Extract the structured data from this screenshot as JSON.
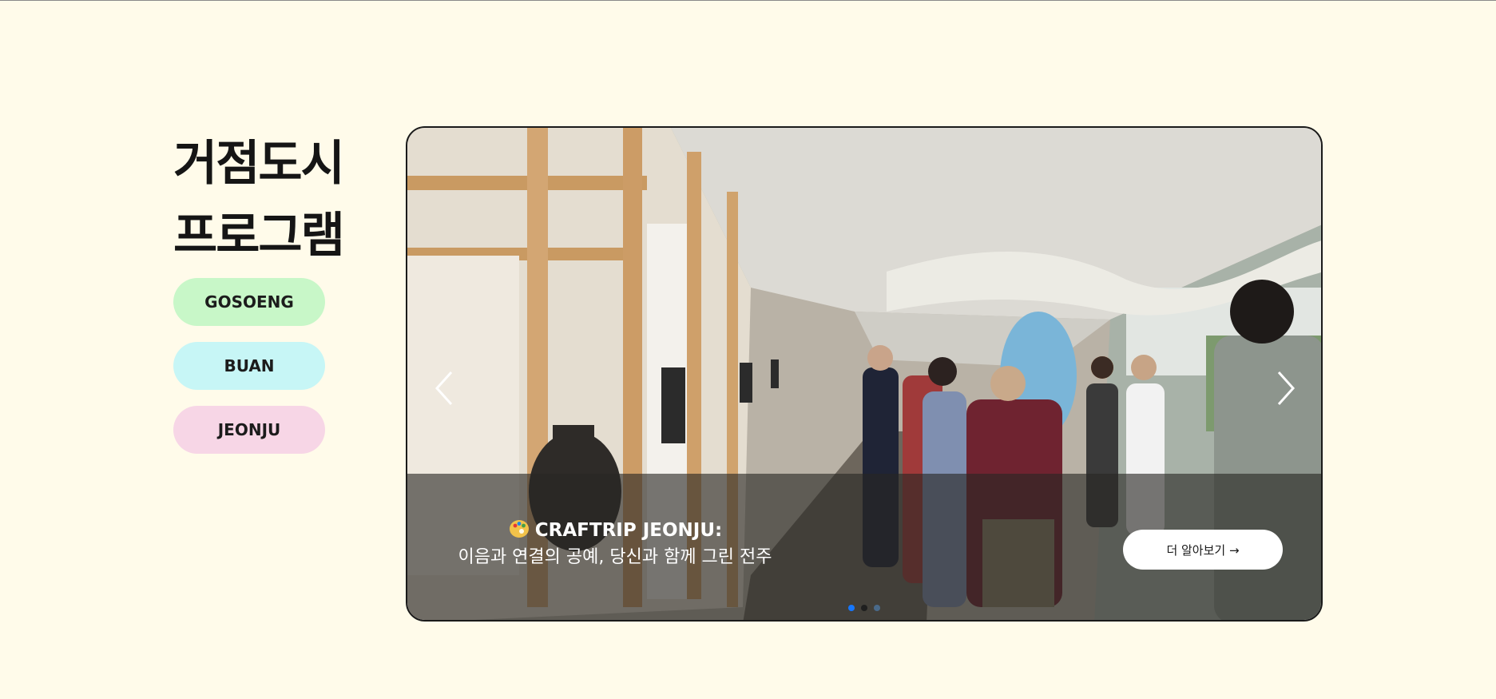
{
  "page": {
    "background": "#fffbea"
  },
  "sidebar": {
    "title_line1": "거점도시",
    "title_line2": "프로그램",
    "buttons": [
      {
        "label": "GOSOENG",
        "color": "#c8f7c8"
      },
      {
        "label": "BUAN",
        "color": "#c7f6f6"
      },
      {
        "label": "JEONJU",
        "color": "#f7d6e6"
      }
    ]
  },
  "slider": {
    "slide": {
      "emoji": "palette-icon",
      "title": "CRAFTRIP JEONJU:",
      "subtitle": "이음과 연결의 공예, 당신과 함께 그린 전주",
      "button_label": "더 알아보기 →",
      "image": "gallery-walkway-photo"
    },
    "prev_icon": "chevron-left-icon",
    "next_icon": "chevron-right-icon",
    "dots": [
      {
        "active": true,
        "color": "#1677ff"
      },
      {
        "active": false,
        "color": "#1f1f1f"
      },
      {
        "active": false,
        "color": "#4a6a8a"
      }
    ]
  }
}
